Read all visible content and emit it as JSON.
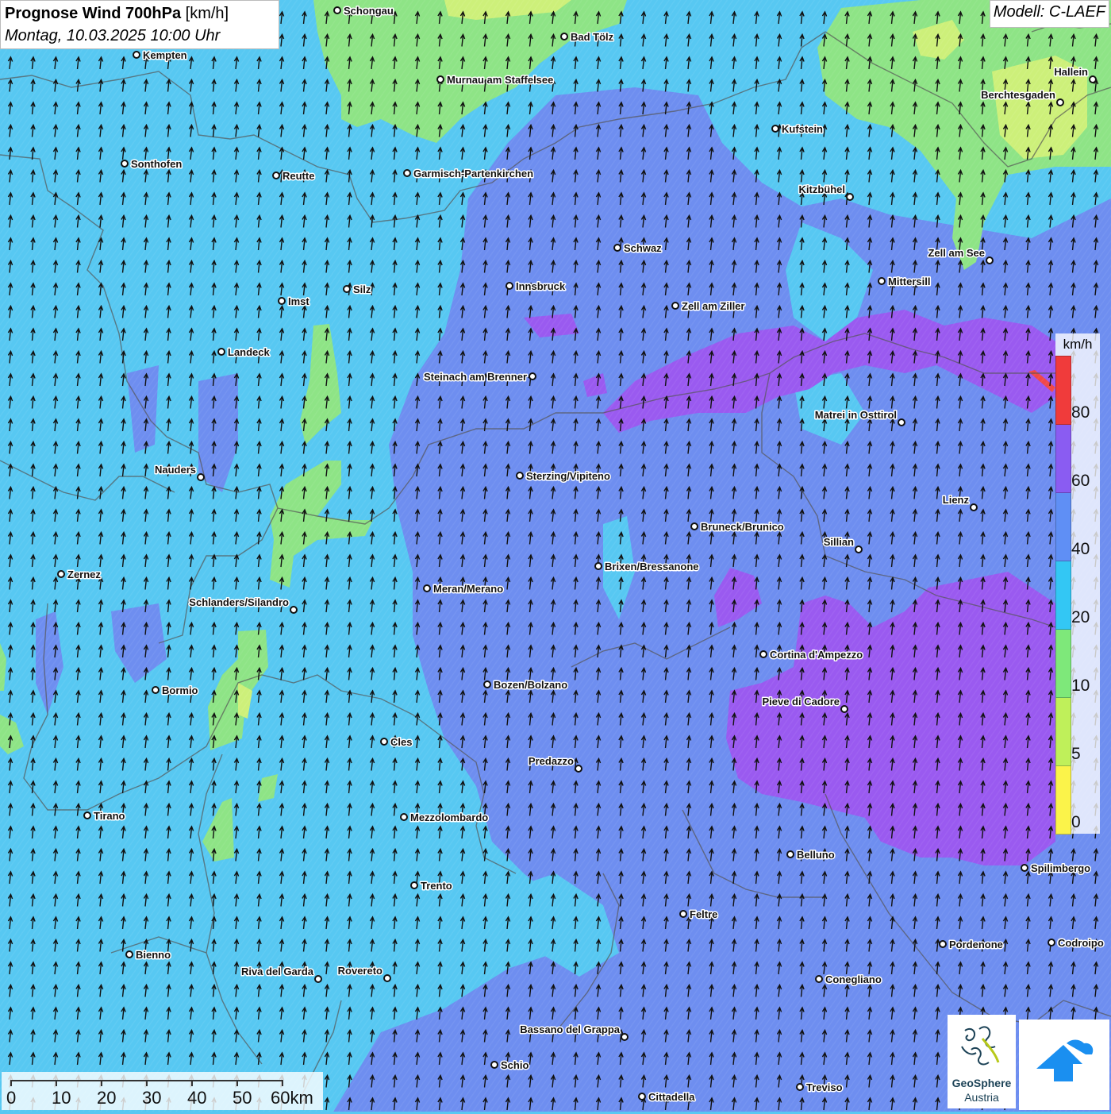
{
  "header": {
    "title_bold": "Prognose Wind 700hPa",
    "title_unit": " [km/h]",
    "datetime": "Montag, 10.03.2025 10:00 Uhr"
  },
  "model_label": "Modell: C-LAEF",
  "legend": {
    "unit": "km/h",
    "classes": [
      {
        "label": "0",
        "color": "#fbf34a"
      },
      {
        "label": "5",
        "color": "#bff05a"
      },
      {
        "label": "10",
        "color": "#7ee87a"
      },
      {
        "label": "20",
        "color": "#33c7f4"
      },
      {
        "label": "40",
        "color": "#5f8ff5"
      },
      {
        "label": "60",
        "color": "#8a5cf2"
      },
      {
        "label": "80",
        "color": "#f03b3b"
      }
    ]
  },
  "scale_bar": {
    "labels": [
      "0",
      "10",
      "20",
      "30",
      "40",
      "50",
      "60km"
    ]
  },
  "logos": {
    "geosphere_line1": "GeoSphere",
    "geosphere_line2": "Austria"
  },
  "cities": [
    {
      "name": "Schongau"
    },
    {
      "name": "Bad Tölz"
    },
    {
      "name": "Kempten"
    },
    {
      "name": "Murnau am Staffelsee"
    },
    {
      "name": "Hallein"
    },
    {
      "name": "Berchtesgaden"
    },
    {
      "name": "Kufstein"
    },
    {
      "name": "Sonthofen"
    },
    {
      "name": "Reutte"
    },
    {
      "name": "Garmisch-Partenkirchen"
    },
    {
      "name": "Kitzbühel"
    },
    {
      "name": "Schwaz"
    },
    {
      "name": "Zell am See"
    },
    {
      "name": "Innsbruck"
    },
    {
      "name": "Mittersill"
    },
    {
      "name": "Imst"
    },
    {
      "name": "Silz"
    },
    {
      "name": "Zell am Ziller"
    },
    {
      "name": "Landeck"
    },
    {
      "name": "Steinach am Brenner"
    },
    {
      "name": "Matrei in Osttirol"
    },
    {
      "name": "Nauders"
    },
    {
      "name": "Sterzing/Vipiteno"
    },
    {
      "name": "Lienz"
    },
    {
      "name": "Bruneck/Brunico"
    },
    {
      "name": "Sillian"
    },
    {
      "name": "Zernez"
    },
    {
      "name": "Brixen/Bressanone"
    },
    {
      "name": "Meran/Merano"
    },
    {
      "name": "Schlanders/Silandro"
    },
    {
      "name": "Cortina d'Ampezzo"
    },
    {
      "name": "Bozen/Bolzano"
    },
    {
      "name": "Bormio"
    },
    {
      "name": "Pieve di Cadore"
    },
    {
      "name": "Cles"
    },
    {
      "name": "Predazzo"
    },
    {
      "name": "Tirano"
    },
    {
      "name": "Mezzolombardo"
    },
    {
      "name": "Belluno"
    },
    {
      "name": "Spilimbergo"
    },
    {
      "name": "Trento"
    },
    {
      "name": "Feltre"
    },
    {
      "name": "Pordenone"
    },
    {
      "name": "Codroipo"
    },
    {
      "name": "Bienno"
    },
    {
      "name": "Riva del Garda"
    },
    {
      "name": "Rovereto"
    },
    {
      "name": "Conegliano"
    },
    {
      "name": "Bassano del Grappa"
    },
    {
      "name": "Schio"
    },
    {
      "name": "Treviso"
    },
    {
      "name": "Cittadella"
    }
  ]
}
